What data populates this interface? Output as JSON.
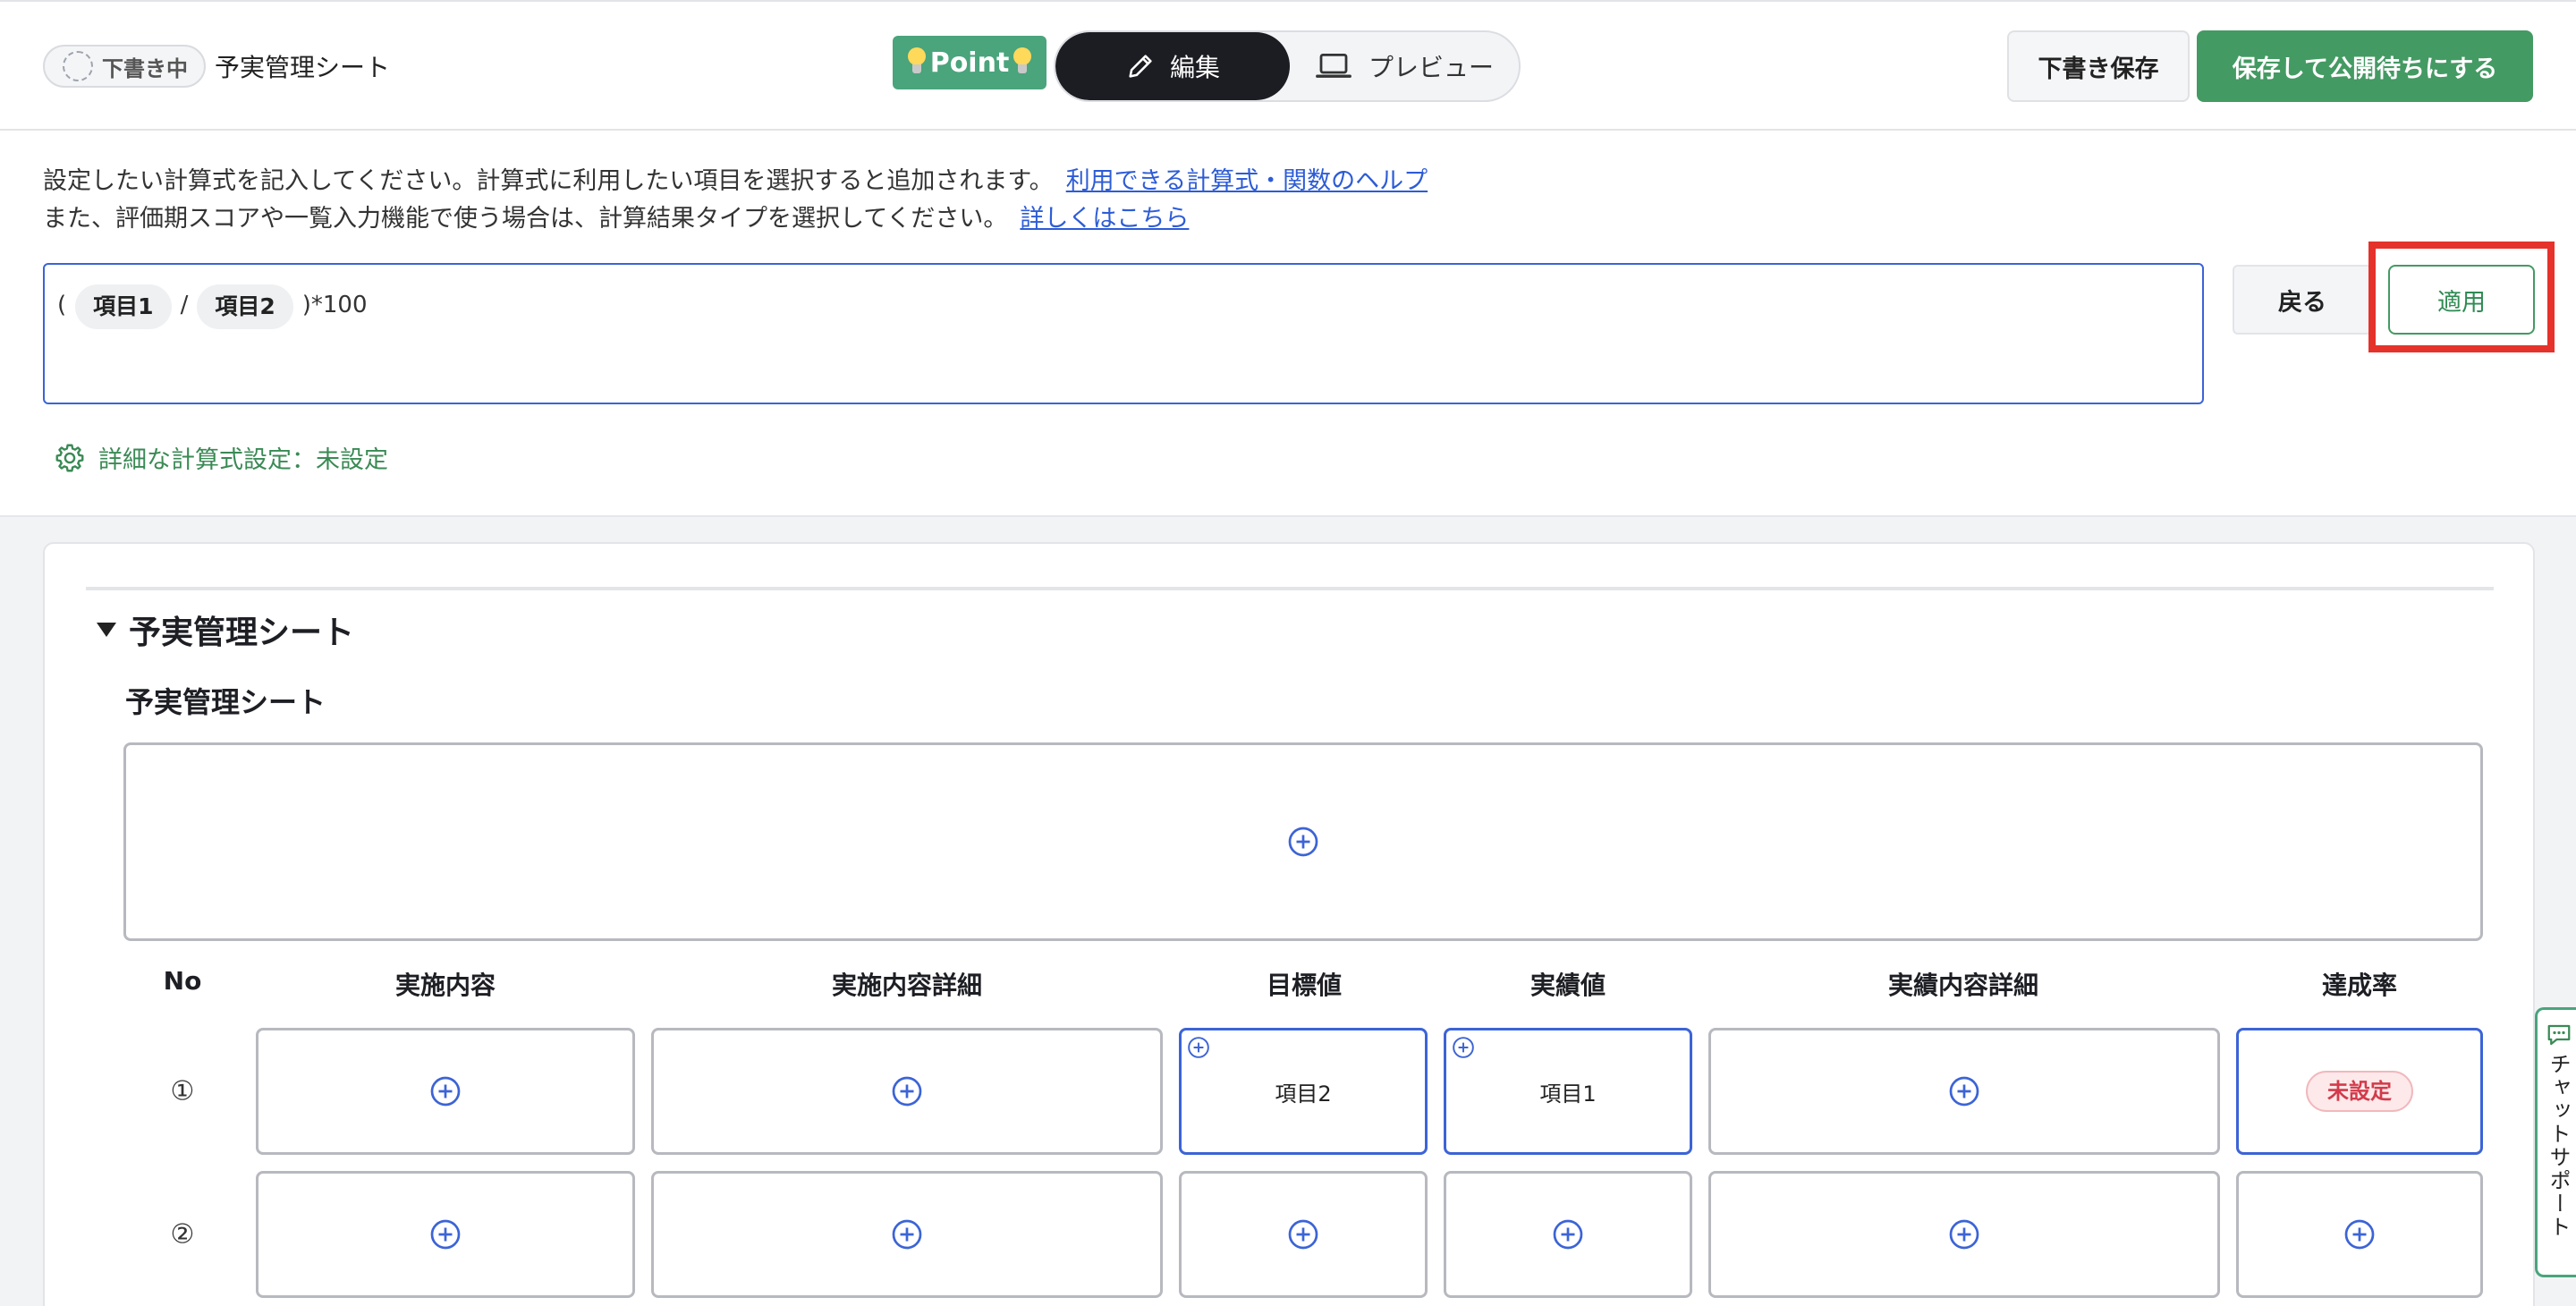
{
  "header": {
    "status_badge": "下書き中",
    "sheet_title": "予実管理シート",
    "point_label": "Point",
    "mode_edit_label": "編集",
    "mode_preview_label": "プレビュー",
    "draft_save_label": "下書き保存",
    "publish_label": "保存して公開待ちにする"
  },
  "formula": {
    "help_line1": "設定したい計算式を記入してください。計算式に利用したい項目を選択すると追加されます。",
    "help_link1": "利用できる計算式・関数のヘルプ",
    "help_line2": "また、評価期スコアや一覧入力機能で使う場合は、計算結果タイプを選択してください。",
    "help_link2": "詳しくはこちら",
    "open_paren": "(",
    "chip1": "項目1",
    "divide": "/",
    "chip2": "項目2",
    "tail": ")*100",
    "back_label": "戻る",
    "apply_label": "適用",
    "advanced_setting": "詳細な計算式設定：未設定"
  },
  "sheet": {
    "section_title": "予実管理シート",
    "subtitle": "予実管理シート",
    "columns": [
      "No",
      "実施内容",
      "実施内容詳細",
      "目標値",
      "実績値",
      "実績内容詳細",
      "達成率"
    ],
    "rows": [
      {
        "no": "①",
        "target_value": "項目2",
        "actual_value": "項目1",
        "rate_badge": "未設定"
      },
      {
        "no": "②"
      }
    ]
  },
  "chat_support": {
    "label": "チャットサポート"
  },
  "colors": {
    "brand_green": "#449a63",
    "link_blue": "#2d5cd6",
    "focus_blue": "#3c64d6",
    "highlight_red": "#e5322b",
    "unset_red": "#d23b4b"
  }
}
